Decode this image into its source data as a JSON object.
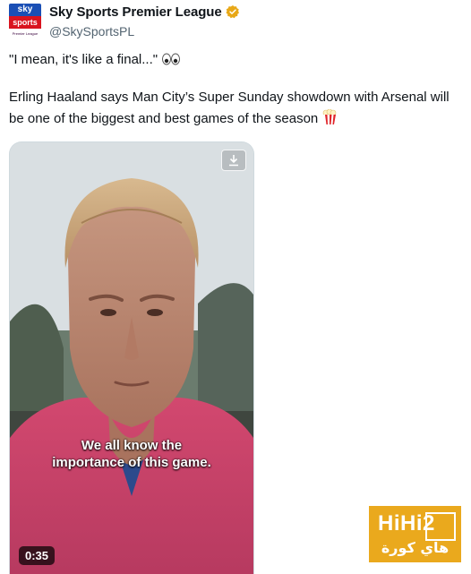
{
  "account": {
    "name": "Sky Sports Premier League",
    "handle": "@SkySportsPL",
    "logo_top": "sky",
    "logo_bottom": "sports",
    "logo_footer": "Premier League",
    "verified_badge": "gold-verified-badge-icon"
  },
  "tweet": {
    "quote": "\"I mean, it's like a final...\"",
    "quote_emoji": "eyes-emoji",
    "body": "Erling Haaland says Man City’s Super Sunday showdown with Arsenal will be one of the biggest and best games of the season",
    "body_emoji": "popcorn-emoji"
  },
  "video": {
    "caption_line1": "We all know the",
    "caption_line2": "importance of this game.",
    "duration": "0:35",
    "download_icon": "download-icon"
  },
  "watermark": {
    "brand": "HiHi2",
    "arabic": "هاي كورة"
  },
  "colors": {
    "badge": "#e8a817",
    "sky_blue": "#1a4fb5",
    "sky_red": "#d9141f",
    "watermark_bg": "#eaa91d",
    "jacket": "#d2486f"
  }
}
